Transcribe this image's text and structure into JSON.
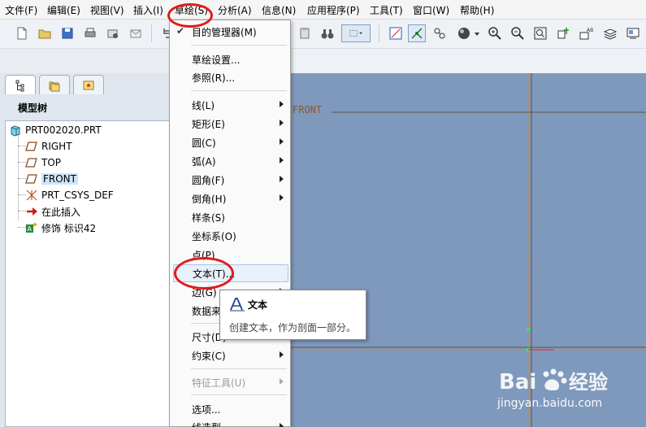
{
  "menubar": {
    "items": [
      "文件(F)",
      "编辑(E)",
      "视图(V)",
      "插入(I)",
      "草绘(S)",
      "分析(A)",
      "信息(N)",
      "应用程序(P)",
      "工具(T)",
      "窗口(W)",
      "帮助(H)"
    ]
  },
  "dropdown": {
    "items": [
      {
        "label": "目的管理器(M)",
        "checked": true
      },
      {
        "label": "草绘设置..."
      },
      {
        "label": "参照(R)..."
      },
      {
        "label": "线(L)",
        "submenu": true
      },
      {
        "label": "矩形(E)",
        "submenu": true
      },
      {
        "label": "圆(C)",
        "submenu": true
      },
      {
        "label": "弧(A)",
        "submenu": true
      },
      {
        "label": "圆角(F)",
        "submenu": true
      },
      {
        "label": "倒角(H)",
        "submenu": true
      },
      {
        "label": "样条(S)"
      },
      {
        "label": "坐标系(O)"
      },
      {
        "label": "点(P)"
      },
      {
        "label": "文本(T)...",
        "hover": true
      },
      {
        "label": "边(G)",
        "submenu": true
      },
      {
        "label": "数据来"
      },
      {
        "label": "尺寸(D)"
      },
      {
        "label": "约束(C)",
        "submenu": true
      },
      {
        "label": "特征工具(U)",
        "submenu": true,
        "disabled": true
      },
      {
        "label": "选项..."
      },
      {
        "label": "线造型",
        "submenu": true
      }
    ]
  },
  "tooltip": {
    "title": "文本",
    "description": "创建文本，作为剖面一部分。"
  },
  "model_tree": {
    "title": "模型树",
    "nodes": [
      {
        "label": "PRT002020.PRT",
        "icon": "part-icon"
      },
      {
        "label": "RIGHT",
        "icon": "datum-plane-icon"
      },
      {
        "label": "TOP",
        "icon": "datum-plane-icon"
      },
      {
        "label": "FRONT",
        "icon": "datum-plane-icon",
        "selected": true
      },
      {
        "label": "PRT_CSYS_DEF",
        "icon": "csys-icon"
      },
      {
        "label": "在此插入",
        "icon": "insert-arrow-icon"
      },
      {
        "label": "修饰 标识42",
        "icon": "cosmetic-sketch-icon"
      }
    ]
  },
  "graphics": {
    "plane_label": "FRONT"
  },
  "watermark": {
    "text": "jingyan.baidu.com"
  },
  "colors": {
    "graphics_bg": "#7f99bd",
    "annotation_red": "#e21a1a",
    "datum_orange": "#d9822b",
    "selection": "#cde4f7"
  }
}
